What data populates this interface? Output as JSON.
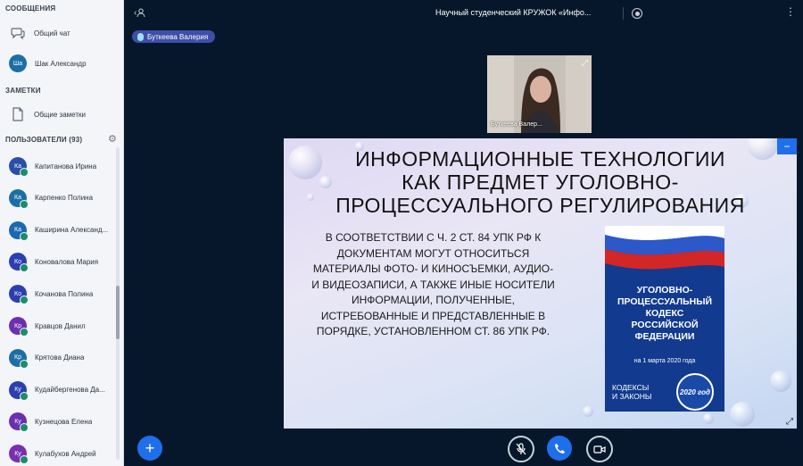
{
  "sidebar": {
    "messages_header": "СООБЩЕНИЯ",
    "public_chat": "Общий чат",
    "private_chat": {
      "initials": "Ша",
      "name": "Шак Александр"
    },
    "notes_header": "ЗАМЕТКИ",
    "shared_notes": "Общие заметки",
    "users_header": "ПОЛЬЗОВАТЕЛИ (93)",
    "users": [
      {
        "initials": "Ка",
        "name": "Капитанова Ирина"
      },
      {
        "initials": "Ка",
        "name": "Карпенко Полина"
      },
      {
        "initials": "Ка",
        "name": "Каширина Александ..."
      },
      {
        "initials": "Ко",
        "name": "Коновалова Мария"
      },
      {
        "initials": "Ко",
        "name": "Кочанова Полина"
      },
      {
        "initials": "Кр",
        "name": "Кравцов Данил"
      },
      {
        "initials": "Кр",
        "name": "Крятова Диана"
      },
      {
        "initials": "Ку",
        "name": "Кудайбергенова Да..."
      },
      {
        "initials": "Ку",
        "name": "Кузнецова Елена"
      },
      {
        "initials": "Ку",
        "name": "Кулабухов Андрей"
      }
    ]
  },
  "header": {
    "title": "Научный студенческий КРУЖОК «Инфо..."
  },
  "presenter": {
    "name": "Буткеева Валерия"
  },
  "webcam": {
    "name": "Буткеева Валер..."
  },
  "slide": {
    "title": "ИНФОРМАЦИОННЫЕ ТЕХНОЛОГИИ\nКАК ПРЕДМЕТ УГОЛОВНО-\nПРОЦЕССУАЛЬНОГО РЕГУЛИРОВАНИЯ",
    "body": "В СООТВЕТСТВИИ С Ч. 2 СТ. 84 УПК РФ К ДОКУМЕНТАМ МОГУТ ОТНОСИТЬСЯ МАТЕРИАЛЫ ФОТО- И КИНОСЪЕМКИ, АУДИО- И ВИДЕОЗАПИСИ, А ТАКЖЕ ИНЫЕ НОСИТЕЛИ ИНФОРМАЦИИ, ПОЛУЧЕННЫЕ, ИСТРЕБОВАННЫЕ И ПРЕДСТАВЛЕННЫЕ В ПОРЯДКЕ, УСТАНОВЛЕННОМ СТ. 86 УПК РФ.",
    "book": {
      "title": "УГОЛОВНО-\nПРОЦЕССУАЛЬНЫЙ\nКОДЕКС\nРОССИЙСКОЙ\nФЕДЕРАЦИИ",
      "date": "на 1 марта 2020 года",
      "series": "КОДЕКСЫ\nИ ЗАКОНЫ",
      "seal": "2020 год"
    }
  },
  "colors": {
    "background": "#06172b",
    "accent": "#1f6feb",
    "presenter_chip": "#3f4fa8"
  },
  "icons": {
    "back": "user-back-icon",
    "record": "record-icon",
    "settings": "gear-icon",
    "plus": "plus-icon",
    "mic": "microphone-icon",
    "phone": "phone-icon",
    "camera": "camera-icon"
  }
}
